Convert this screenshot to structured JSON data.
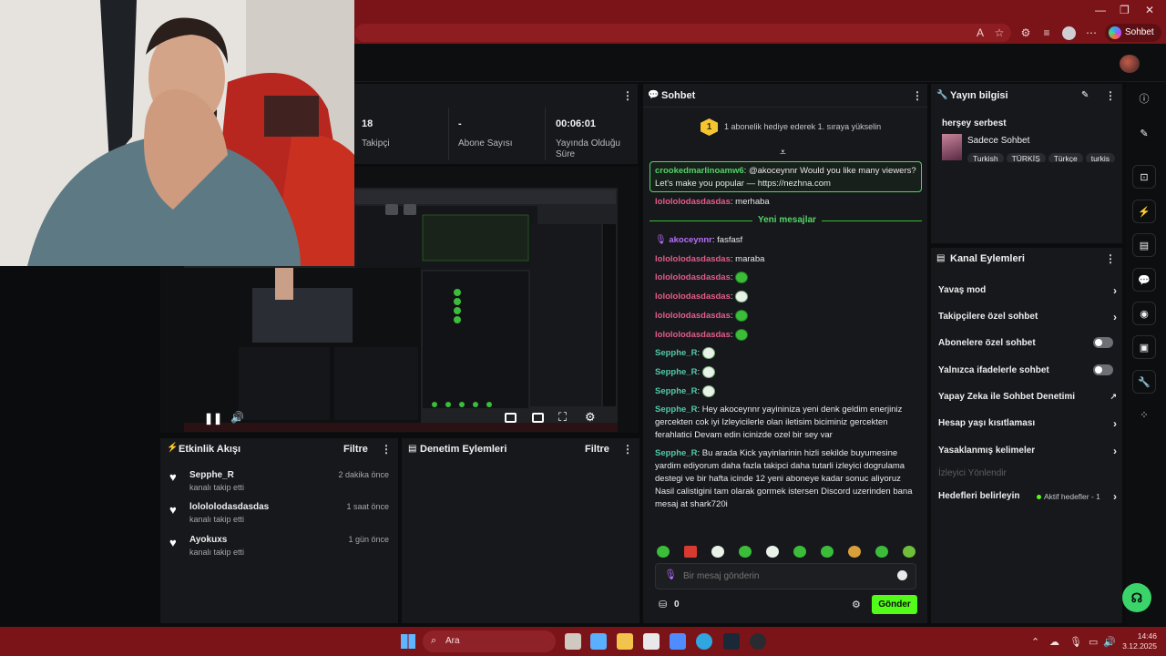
{
  "browser": {
    "copilot_label": "Sohbet et"
  },
  "stats": {
    "followers": {
      "value": "18",
      "label": "Takipçi"
    },
    "subscribers": {
      "value": "-",
      "label": "Abone Sayısı"
    },
    "uptime": {
      "value": "00:06:01",
      "label": "Yayında Olduğu Süre"
    }
  },
  "activity": {
    "title": "Etkinlik Akışı",
    "filter": "Filtre",
    "events": [
      {
        "name": "Sepphe_R",
        "sub": "kanalı takip etti",
        "time": "2 dakika önce"
      },
      {
        "name": "lolololodasdasdas",
        "sub": "kanalı takip etti",
        "time": "1 saat önce"
      },
      {
        "name": "Ayokuxs",
        "sub": "kanalı takip etti",
        "time": "1 gün önce"
      }
    ]
  },
  "moderation": {
    "title": "Denetim Eylemleri",
    "filter": "Filtre"
  },
  "chat": {
    "title": "Sohbet",
    "gift_rank": "1",
    "gift_banner": "1 abonelik hediye ederek 1. sıraya yükselin",
    "pinned_user": "crookedmarlinoamw6",
    "pinned_text": ": @akoceynnr Would you like many viewers? Let's make you popular — https://nezhna.com",
    "msg1_user": "lolololodasdasdas",
    "msg1_text": ": merhaba",
    "new_messages": "Yeni mesajlar",
    "msg2_user": "akoceynnr",
    "msg2_text": ": fasfasf",
    "msg3_user": "lolololodasdasdas",
    "msg3_text": ": maraba",
    "emote_user": "lolololodasdasdas",
    "emote_user2": "Sepphe_R",
    "long1_user": "Sepphe_R",
    "long1_text": ": Hey akoceynnr yayininiza yeni denk geldim enerjiniz gercekten cok iyi Izleyicilerle olan iletisim biciminiz gercekten ferahlatici Devam edin icinizde ozel bir sey var",
    "long2_user": "Sepphe_R",
    "long2_text": ": Bu arada Kick yayinlarinin hizli sekilde buyumesine yardim ediyorum daha fazla takipci daha tutarli izleyici dogrulama destegi ve bir hafta icinde 12 yeni aboneye kadar sonuc aliyoruz Nasil calistigini tam olarak gormek istersen Discord uzerinden bana mesaj at shark720i",
    "input_placeholder": "Bir mesaj gönderin",
    "points": "0",
    "send_label": "Gönder"
  },
  "stream_info": {
    "title": "Yayın bilgisi",
    "stream_title": "herşey serbest",
    "category": "Sadece Sohbet",
    "tags": [
      "Turkish",
      "TÜRKİŞ",
      "Türkçe",
      "turkis"
    ]
  },
  "channel_actions": {
    "title": "Kanal Eylemleri",
    "items": [
      {
        "label": "Yavaş mod",
        "type": "chevron"
      },
      {
        "label": "Takipçilere özel sohbet",
        "type": "chevron"
      },
      {
        "label": "Abonelere özel sohbet",
        "type": "toggle"
      },
      {
        "label": "Yalnızca ifadelerle sohbet",
        "type": "toggle"
      },
      {
        "label": "Yapay Zeka ile Sohbet Denetimi",
        "type": "external"
      },
      {
        "label": "Hesap yaşı kısıtlaması",
        "type": "chevron"
      },
      {
        "label": "Yasaklanmış kelimeler",
        "type": "chevron"
      },
      {
        "label": "İzleyici Yönlendir",
        "type": "disabled"
      },
      {
        "label": "Hedefleri belirleyin",
        "type": "chevron"
      }
    ],
    "goals_status": "Aktif hedefler - 1"
  },
  "taskbar": {
    "search_label": "Ara",
    "time": "14:46",
    "date": "3.12.2025"
  },
  "colors": {
    "accent_green": "#53fc18",
    "bg_panel": "#17181b",
    "taskbar_red": "#7a1418"
  }
}
